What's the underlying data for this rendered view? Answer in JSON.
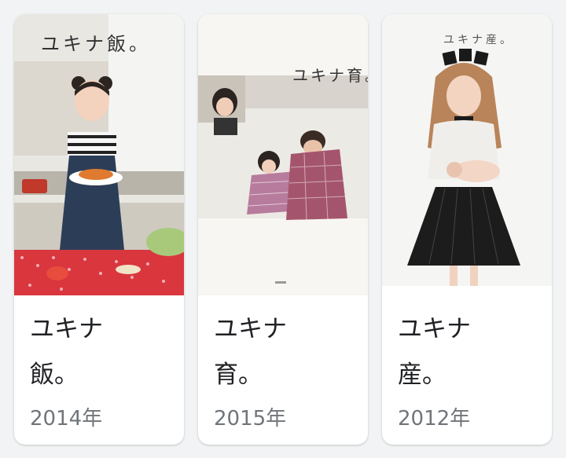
{
  "books": [
    {
      "cover_title": "ユキナ飯。",
      "title_line1": "ユキナ",
      "title_line2": "飯。",
      "year": "2014年"
    },
    {
      "cover_title": "ユキナ育。",
      "title_line1": "ユキナ",
      "title_line2": "育。",
      "year": "2015年"
    },
    {
      "cover_title": "ユキナ産。",
      "title_line1": "ユキナ",
      "title_line2": "産。",
      "year": "2012年"
    }
  ]
}
